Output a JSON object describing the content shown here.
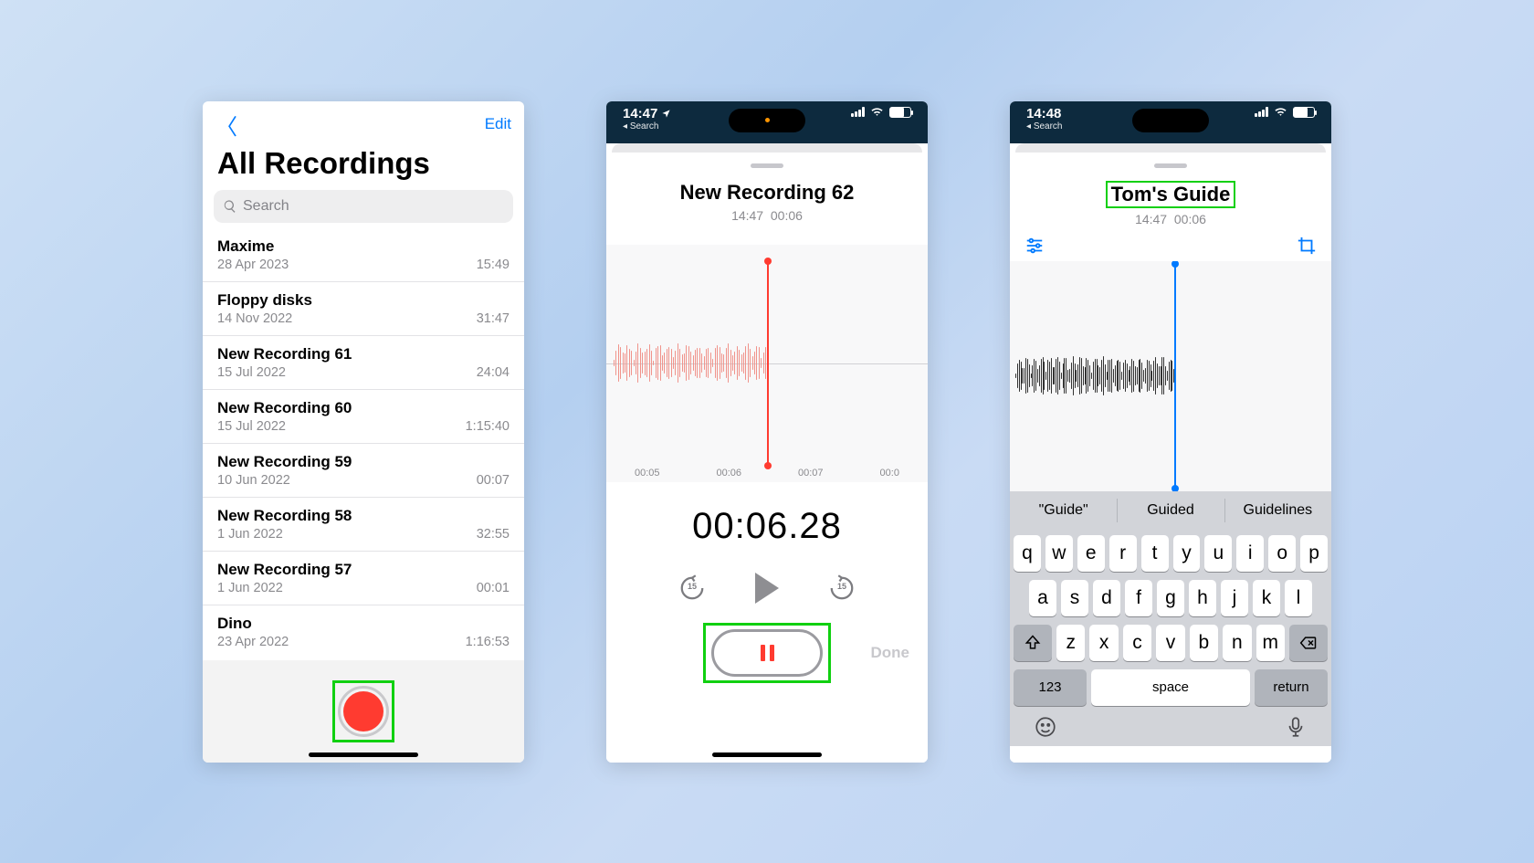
{
  "screen1": {
    "edit_label": "Edit",
    "title": "All Recordings",
    "search_placeholder": "Search",
    "recordings": [
      {
        "title": "Maxime",
        "date": "28 Apr 2023",
        "duration": "15:49"
      },
      {
        "title": "Floppy disks",
        "date": "14 Nov 2022",
        "duration": "31:47"
      },
      {
        "title": "New Recording 61",
        "date": "15 Jul 2022",
        "duration": "24:04"
      },
      {
        "title": "New Recording 60",
        "date": "15 Jul 2022",
        "duration": "1:15:40"
      },
      {
        "title": "New Recording 59",
        "date": "10 Jun 2022",
        "duration": "00:07"
      },
      {
        "title": "New Recording 58",
        "date": "1 Jun 2022",
        "duration": "32:55"
      },
      {
        "title": "New Recording 57",
        "date": "1 Jun 2022",
        "duration": "00:01"
      },
      {
        "title": "Dino",
        "date": "23 Apr 2022",
        "duration": "1:16:53"
      }
    ]
  },
  "screen2": {
    "status_time": "14:47",
    "status_back": "Search",
    "title": "New Recording 62",
    "meta_time": "14:47",
    "meta_dur": "00:06",
    "ticks": [
      "00:05",
      "00:06",
      "00:07",
      "00:0"
    ],
    "timer": "00:06.28",
    "skip_amount": "15",
    "done_label": "Done"
  },
  "screen3": {
    "status_time": "14:48",
    "status_back": "Search",
    "title": "Tom's Guide",
    "meta_time": "14:47",
    "meta_dur": "00:06",
    "suggestions": [
      "\"Guide\"",
      "Guided",
      "Guidelines"
    ],
    "keys_r1": [
      "q",
      "w",
      "e",
      "r",
      "t",
      "y",
      "u",
      "i",
      "o",
      "p"
    ],
    "keys_r2": [
      "a",
      "s",
      "d",
      "f",
      "g",
      "h",
      "j",
      "k",
      "l"
    ],
    "keys_r3": [
      "z",
      "x",
      "c",
      "v",
      "b",
      "n",
      "m"
    ],
    "k123": "123",
    "kspace": "space",
    "kreturn": "return"
  }
}
